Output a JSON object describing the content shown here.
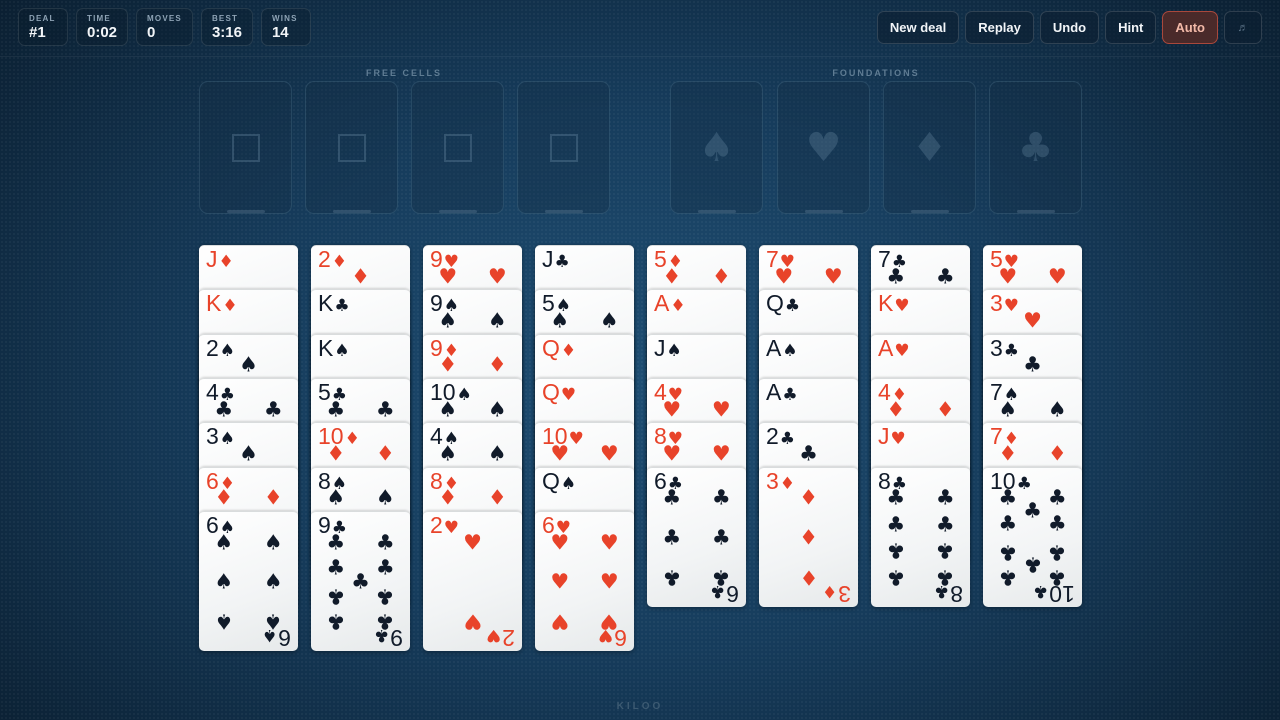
{
  "stats": [
    {
      "id": "deal",
      "label": "DEAL",
      "value": "#1"
    },
    {
      "id": "time",
      "label": "TIME",
      "value": "0:02"
    },
    {
      "id": "moves",
      "label": "MOVES",
      "value": "0"
    },
    {
      "id": "best",
      "label": "BEST",
      "value": "3:16"
    },
    {
      "id": "wins",
      "label": "WINS",
      "value": "14"
    }
  ],
  "actions": [
    {
      "id": "new-deal",
      "label": "New deal",
      "active": false
    },
    {
      "id": "replay",
      "label": "Replay",
      "active": false
    },
    {
      "id": "undo",
      "label": "Undo",
      "active": false
    },
    {
      "id": "hint",
      "label": "Hint",
      "active": false
    },
    {
      "id": "auto",
      "label": "Auto",
      "active": true
    },
    {
      "id": "sound",
      "label": "♬",
      "icon": "music-note-icon",
      "active": false
    }
  ],
  "labels": {
    "free_cells": "FREE CELLS",
    "foundations": "FOUNDATIONS"
  },
  "free_cells": [
    "",
    "",
    "",
    ""
  ],
  "foundations": [
    {
      "suit": "spades",
      "symbol": "♠",
      "icon": "spade-icon"
    },
    {
      "suit": "hearts",
      "symbol": "♥",
      "icon": "heart-icon"
    },
    {
      "suit": "diamonds",
      "symbol": "♦",
      "icon": "diamond-icon"
    },
    {
      "suit": "clubs",
      "symbol": "♣",
      "icon": "club-icon"
    }
  ],
  "colors": {
    "red": "#e8432a",
    "black": "#111b2a",
    "accent": "#a9483c"
  },
  "tableau": [
    [
      {
        "rank": "J",
        "suit": "♦"
      },
      {
        "rank": "K",
        "suit": "♦"
      },
      {
        "rank": "2",
        "suit": "♠"
      },
      {
        "rank": "4",
        "suit": "♣"
      },
      {
        "rank": "3",
        "suit": "♠"
      },
      {
        "rank": "6",
        "suit": "♦"
      },
      {
        "rank": "6",
        "suit": "♠"
      }
    ],
    [
      {
        "rank": "2",
        "suit": "♦"
      },
      {
        "rank": "K",
        "suit": "♣"
      },
      {
        "rank": "K",
        "suit": "♠"
      },
      {
        "rank": "5",
        "suit": "♣"
      },
      {
        "rank": "10",
        "suit": "♦"
      },
      {
        "rank": "8",
        "suit": "♠"
      },
      {
        "rank": "9",
        "suit": "♣"
      }
    ],
    [
      {
        "rank": "9",
        "suit": "♥"
      },
      {
        "rank": "9",
        "suit": "♠"
      },
      {
        "rank": "9",
        "suit": "♦"
      },
      {
        "rank": "10",
        "suit": "♠"
      },
      {
        "rank": "4",
        "suit": "♠"
      },
      {
        "rank": "8",
        "suit": "♦"
      },
      {
        "rank": "2",
        "suit": "♥"
      }
    ],
    [
      {
        "rank": "J",
        "suit": "♣"
      },
      {
        "rank": "5",
        "suit": "♠"
      },
      {
        "rank": "Q",
        "suit": "♦"
      },
      {
        "rank": "Q",
        "suit": "♥"
      },
      {
        "rank": "10",
        "suit": "♥"
      },
      {
        "rank": "Q",
        "suit": "♠"
      },
      {
        "rank": "6",
        "suit": "♥"
      }
    ],
    [
      {
        "rank": "5",
        "suit": "♦"
      },
      {
        "rank": "A",
        "suit": "♦"
      },
      {
        "rank": "J",
        "suit": "♠"
      },
      {
        "rank": "4",
        "suit": "♥"
      },
      {
        "rank": "8",
        "suit": "♥"
      },
      {
        "rank": "6",
        "suit": "♣"
      }
    ],
    [
      {
        "rank": "7",
        "suit": "♥"
      },
      {
        "rank": "Q",
        "suit": "♣"
      },
      {
        "rank": "A",
        "suit": "♠"
      },
      {
        "rank": "A",
        "suit": "♣"
      },
      {
        "rank": "2",
        "suit": "♣"
      },
      {
        "rank": "3",
        "suit": "♦"
      }
    ],
    [
      {
        "rank": "7",
        "suit": "♣"
      },
      {
        "rank": "K",
        "suit": "♥"
      },
      {
        "rank": "A",
        "suit": "♥"
      },
      {
        "rank": "4",
        "suit": "♦"
      },
      {
        "rank": "J",
        "suit": "♥"
      },
      {
        "rank": "8",
        "suit": "♣"
      }
    ],
    [
      {
        "rank": "5",
        "suit": "♥"
      },
      {
        "rank": "3",
        "suit": "♥"
      },
      {
        "rank": "3",
        "suit": "♣"
      },
      {
        "rank": "7",
        "suit": "♠"
      },
      {
        "rank": "7",
        "suit": "♦"
      },
      {
        "rank": "10",
        "suit": "♣"
      }
    ]
  ],
  "brand": "KILOO"
}
